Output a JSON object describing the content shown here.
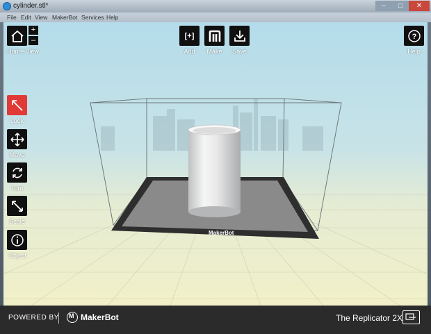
{
  "window": {
    "title": "cylinder.stl*"
  },
  "menu": [
    "File",
    "Edit",
    "View",
    "MakerBot",
    "Services",
    "Help"
  ],
  "top_toolbar": {
    "home_view_label": "Home View",
    "add_icon_text": "[+]",
    "add_label": "Add",
    "make_label": "Make",
    "save_label": "Save",
    "help_label": "Help"
  },
  "left_toolbar": [
    {
      "label": "Look",
      "icon": "look-icon",
      "active": true
    },
    {
      "label": "Move",
      "icon": "move-icon",
      "active": false
    },
    {
      "label": "Turn",
      "icon": "turn-icon",
      "active": false
    },
    {
      "label": "Scale",
      "icon": "scale-icon",
      "active": false
    },
    {
      "label": "Object",
      "icon": "object-info-icon",
      "active": false
    }
  ],
  "build_plate_brand": "MakerBot",
  "footer": {
    "powered_by": "POWERED BY",
    "brand": "MakerBot",
    "printer": "The Replicator 2X"
  },
  "colors": {
    "active_tool": "#e13a36",
    "button_bg": "#101010",
    "footer_bg": "#2b2b2b"
  }
}
